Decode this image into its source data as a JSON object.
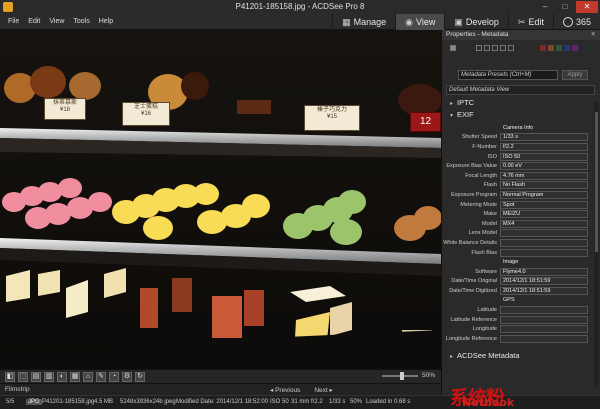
{
  "window": {
    "title": "P41201-185158.jpg - ACDSee Pro 8",
    "minimize": "–",
    "maximize": "□",
    "close": "✕"
  },
  "menu": [
    "File",
    "Edit",
    "View",
    "Tools",
    "Help"
  ],
  "modes": [
    {
      "label": "Manage",
      "icon": "grid-icon",
      "glyph": "▦",
      "active": false
    },
    {
      "label": "View",
      "icon": "eye-icon",
      "glyph": "◉",
      "active": true
    },
    {
      "label": "Develop",
      "icon": "develop-icon",
      "glyph": "▣",
      "active": false
    },
    {
      "label": "Edit",
      "icon": "edit-tools-icon",
      "glyph": "✂",
      "active": false
    },
    {
      "label": "365",
      "icon": "circle-365-icon",
      "glyph": "",
      "active": false
    }
  ],
  "price_tags": [
    {
      "name": "tag-1",
      "text": "抹茶慕斯\n¥18"
    },
    {
      "name": "tag-2",
      "text": "芝士蛋糕\n¥16"
    },
    {
      "name": "tag-3",
      "text": "榛子巧克力\n¥15"
    },
    {
      "name": "tag-4",
      "text": "12"
    }
  ],
  "toolstrip": {
    "tools": [
      "◧",
      "⬚",
      "▤",
      "▥",
      "◐",
      "▦",
      "⌂",
      "✎",
      "◔",
      "⚙",
      "↻"
    ],
    "zoom": "50%"
  },
  "filmstrip": {
    "label": "Filmstrip",
    "previous": "◂ Previous",
    "next": "Next ▸"
  },
  "status": {
    "index": "5/5",
    "type": "JPG",
    "filename": "P41201-185158.jpg",
    "size": "4.5 MB",
    "dimensions": "5248x3936x24b jpeg",
    "modified": "Modified Date: 2014/12/1 18:52:00",
    "iso": "ISO 50",
    "focal": "31 mm",
    "fnum": "f/2.2",
    "shutter": "1/33 s",
    "zoom": "50%",
    "loaded": "Loaded in 0.68 s"
  },
  "panel": {
    "title": "Properties - Metadata",
    "pin": "✕",
    "rating_labels": [
      "1",
      "2",
      "3",
      "4",
      "5"
    ],
    "color_labels": [
      "#c0392b",
      "#e67e22",
      "#2ecc71",
      "#3498db",
      "#8e44ad"
    ],
    "preset": "Metadata Presets (Ctrl+M)",
    "apply": "Apply",
    "view": "Default Metadata View",
    "sections": {
      "iptc": "IPTC",
      "exif": "EXIF",
      "acdsee": "ACDSee Metadata"
    },
    "exif_rows": [
      {
        "label": "",
        "value": "Camera Info",
        "plain": true
      },
      {
        "label": "Shutter Speed",
        "value": "1/33 s",
        "plain": false
      },
      {
        "label": "F-Number",
        "value": "f/2.2",
        "plain": false
      },
      {
        "label": "ISO",
        "value": "ISO 50",
        "plain": false
      },
      {
        "label": "Exposure Bias Value",
        "value": "0.00 eV",
        "plain": false
      },
      {
        "label": "Focal Length",
        "value": "4.76 mm",
        "plain": false
      },
      {
        "label": "Flash",
        "value": "No Flash",
        "plain": false
      },
      {
        "label": "Exposure Program",
        "value": "Normal Program",
        "plain": false
      },
      {
        "label": "Metering Mode",
        "value": "Spot",
        "plain": false
      },
      {
        "label": "Make",
        "value": "MEIZU",
        "plain": false
      },
      {
        "label": "Model",
        "value": "MX4",
        "plain": false
      },
      {
        "label": "Lens Model",
        "value": "",
        "plain": false
      },
      {
        "label": "White Balance Details",
        "value": "",
        "plain": false
      },
      {
        "label": "Flash Bias",
        "value": "",
        "plain": false
      },
      {
        "label": "",
        "value": "Image",
        "plain": true
      },
      {
        "label": "Software",
        "value": "Flyme4.0",
        "plain": false
      },
      {
        "label": "Date/Time Original",
        "value": "2014/12/1 18:51:59",
        "plain": false
      },
      {
        "label": "Date/Time Digitized",
        "value": "2014/12/1 18:51:59",
        "plain": false
      },
      {
        "label": "",
        "value": "GPS",
        "plain": true
      },
      {
        "label": "Latitude",
        "value": "",
        "plain": false
      },
      {
        "label": "Latitude Reference",
        "value": "",
        "plain": false
      },
      {
        "label": "Longitude",
        "value": "",
        "plain": false
      },
      {
        "label": "Longitude Reference",
        "value": "",
        "plain": false
      }
    ]
  },
  "watermark": {
    "main": "系统粉",
    "sub": "Netbook"
  }
}
